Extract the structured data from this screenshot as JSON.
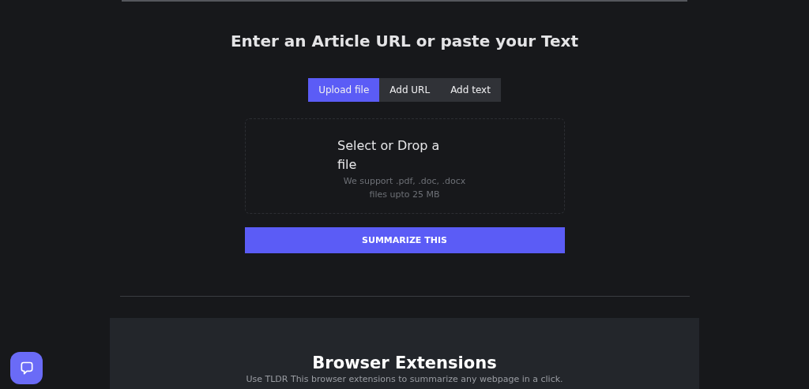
{
  "heading": "Enter an Article URL or paste your Text",
  "tabs": [
    {
      "label": "Upload file",
      "selected": true
    },
    {
      "label": "Add URL",
      "selected": false
    },
    {
      "label": "Add text",
      "selected": false
    }
  ],
  "dropzone": {
    "title": "Select or Drop a file",
    "hint_lines": [
      "We support .pdf, .doc, .docx",
      "files upto 25 MB"
    ]
  },
  "submit_button": "SUMMARIZE THIS",
  "extensions": {
    "title": "Browser Extensions",
    "subtitle": "Use TLDR This browser extensions to summarize any webpage in a click."
  }
}
